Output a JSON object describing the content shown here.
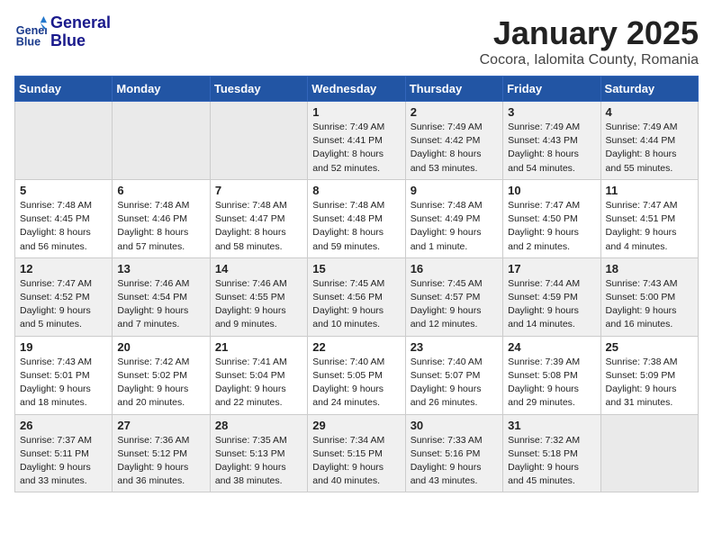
{
  "header": {
    "logo_line1": "General",
    "logo_line2": "Blue",
    "month": "January 2025",
    "location": "Cocora, Ialomita County, Romania"
  },
  "days_of_week": [
    "Sunday",
    "Monday",
    "Tuesday",
    "Wednesday",
    "Thursday",
    "Friday",
    "Saturday"
  ],
  "weeks": [
    [
      {
        "num": "",
        "info": ""
      },
      {
        "num": "",
        "info": ""
      },
      {
        "num": "",
        "info": ""
      },
      {
        "num": "1",
        "info": "Sunrise: 7:49 AM\nSunset: 4:41 PM\nDaylight: 8 hours\nand 52 minutes."
      },
      {
        "num": "2",
        "info": "Sunrise: 7:49 AM\nSunset: 4:42 PM\nDaylight: 8 hours\nand 53 minutes."
      },
      {
        "num": "3",
        "info": "Sunrise: 7:49 AM\nSunset: 4:43 PM\nDaylight: 8 hours\nand 54 minutes."
      },
      {
        "num": "4",
        "info": "Sunrise: 7:49 AM\nSunset: 4:44 PM\nDaylight: 8 hours\nand 55 minutes."
      }
    ],
    [
      {
        "num": "5",
        "info": "Sunrise: 7:48 AM\nSunset: 4:45 PM\nDaylight: 8 hours\nand 56 minutes."
      },
      {
        "num": "6",
        "info": "Sunrise: 7:48 AM\nSunset: 4:46 PM\nDaylight: 8 hours\nand 57 minutes."
      },
      {
        "num": "7",
        "info": "Sunrise: 7:48 AM\nSunset: 4:47 PM\nDaylight: 8 hours\nand 58 minutes."
      },
      {
        "num": "8",
        "info": "Sunrise: 7:48 AM\nSunset: 4:48 PM\nDaylight: 8 hours\nand 59 minutes."
      },
      {
        "num": "9",
        "info": "Sunrise: 7:48 AM\nSunset: 4:49 PM\nDaylight: 9 hours\nand 1 minute."
      },
      {
        "num": "10",
        "info": "Sunrise: 7:47 AM\nSunset: 4:50 PM\nDaylight: 9 hours\nand 2 minutes."
      },
      {
        "num": "11",
        "info": "Sunrise: 7:47 AM\nSunset: 4:51 PM\nDaylight: 9 hours\nand 4 minutes."
      }
    ],
    [
      {
        "num": "12",
        "info": "Sunrise: 7:47 AM\nSunset: 4:52 PM\nDaylight: 9 hours\nand 5 minutes."
      },
      {
        "num": "13",
        "info": "Sunrise: 7:46 AM\nSunset: 4:54 PM\nDaylight: 9 hours\nand 7 minutes."
      },
      {
        "num": "14",
        "info": "Sunrise: 7:46 AM\nSunset: 4:55 PM\nDaylight: 9 hours\nand 9 minutes."
      },
      {
        "num": "15",
        "info": "Sunrise: 7:45 AM\nSunset: 4:56 PM\nDaylight: 9 hours\nand 10 minutes."
      },
      {
        "num": "16",
        "info": "Sunrise: 7:45 AM\nSunset: 4:57 PM\nDaylight: 9 hours\nand 12 minutes."
      },
      {
        "num": "17",
        "info": "Sunrise: 7:44 AM\nSunset: 4:59 PM\nDaylight: 9 hours\nand 14 minutes."
      },
      {
        "num": "18",
        "info": "Sunrise: 7:43 AM\nSunset: 5:00 PM\nDaylight: 9 hours\nand 16 minutes."
      }
    ],
    [
      {
        "num": "19",
        "info": "Sunrise: 7:43 AM\nSunset: 5:01 PM\nDaylight: 9 hours\nand 18 minutes."
      },
      {
        "num": "20",
        "info": "Sunrise: 7:42 AM\nSunset: 5:02 PM\nDaylight: 9 hours\nand 20 minutes."
      },
      {
        "num": "21",
        "info": "Sunrise: 7:41 AM\nSunset: 5:04 PM\nDaylight: 9 hours\nand 22 minutes."
      },
      {
        "num": "22",
        "info": "Sunrise: 7:40 AM\nSunset: 5:05 PM\nDaylight: 9 hours\nand 24 minutes."
      },
      {
        "num": "23",
        "info": "Sunrise: 7:40 AM\nSunset: 5:07 PM\nDaylight: 9 hours\nand 26 minutes."
      },
      {
        "num": "24",
        "info": "Sunrise: 7:39 AM\nSunset: 5:08 PM\nDaylight: 9 hours\nand 29 minutes."
      },
      {
        "num": "25",
        "info": "Sunrise: 7:38 AM\nSunset: 5:09 PM\nDaylight: 9 hours\nand 31 minutes."
      }
    ],
    [
      {
        "num": "26",
        "info": "Sunrise: 7:37 AM\nSunset: 5:11 PM\nDaylight: 9 hours\nand 33 minutes."
      },
      {
        "num": "27",
        "info": "Sunrise: 7:36 AM\nSunset: 5:12 PM\nDaylight: 9 hours\nand 36 minutes."
      },
      {
        "num": "28",
        "info": "Sunrise: 7:35 AM\nSunset: 5:13 PM\nDaylight: 9 hours\nand 38 minutes."
      },
      {
        "num": "29",
        "info": "Sunrise: 7:34 AM\nSunset: 5:15 PM\nDaylight: 9 hours\nand 40 minutes."
      },
      {
        "num": "30",
        "info": "Sunrise: 7:33 AM\nSunset: 5:16 PM\nDaylight: 9 hours\nand 43 minutes."
      },
      {
        "num": "31",
        "info": "Sunrise: 7:32 AM\nSunset: 5:18 PM\nDaylight: 9 hours\nand 45 minutes."
      },
      {
        "num": "",
        "info": ""
      }
    ]
  ]
}
